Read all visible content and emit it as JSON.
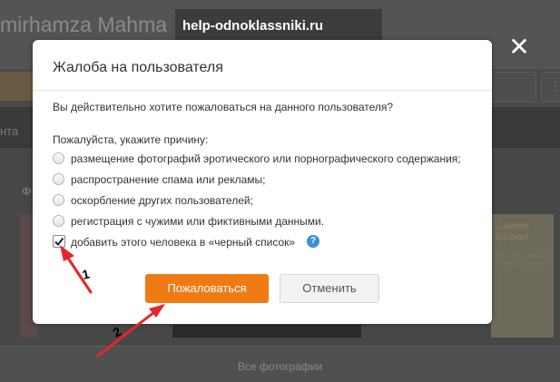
{
  "background": {
    "profile_name": "mirhamza Mahma",
    "tab_partial": "нта",
    "photos_label_partial": "Ф",
    "all_photos_link": "Все фотографии",
    "photo_right_text": "...анкем Байрам",
    "photo_right_small": "Вы 1 не ... Вы Ане ... Я Я ... Не Фато ..."
  },
  "watermark": "help-odnoklassniki.ru",
  "dialog": {
    "title": "Жалоба на пользователя",
    "question": "Вы действительно хотите пожаловаться на данного пользователя?",
    "prompt": "Пожалуйста, укажите причину:",
    "options": [
      {
        "label": "размещение фотографий эротического или порнографического содержания;",
        "selected": false
      },
      {
        "label": "распространение спама или рекламы;",
        "selected": false
      },
      {
        "label": "оскорбление других пользователей;",
        "selected": false
      },
      {
        "label": "регистрация с чужими или фиктивными данными."
      }
    ],
    "blacklist_label": "добавить этого человека в «черный список»",
    "blacklist_checked": true,
    "help_icon_glyph": "?",
    "submit_label": "Пожаловаться",
    "cancel_label": "Отменить",
    "close_glyph": "✕"
  },
  "annotations": {
    "step1": "1",
    "step2": "2",
    "color": "#e8242c"
  },
  "colors": {
    "accent_orange": "#f07b15",
    "help_blue": "#3d8fd8"
  }
}
